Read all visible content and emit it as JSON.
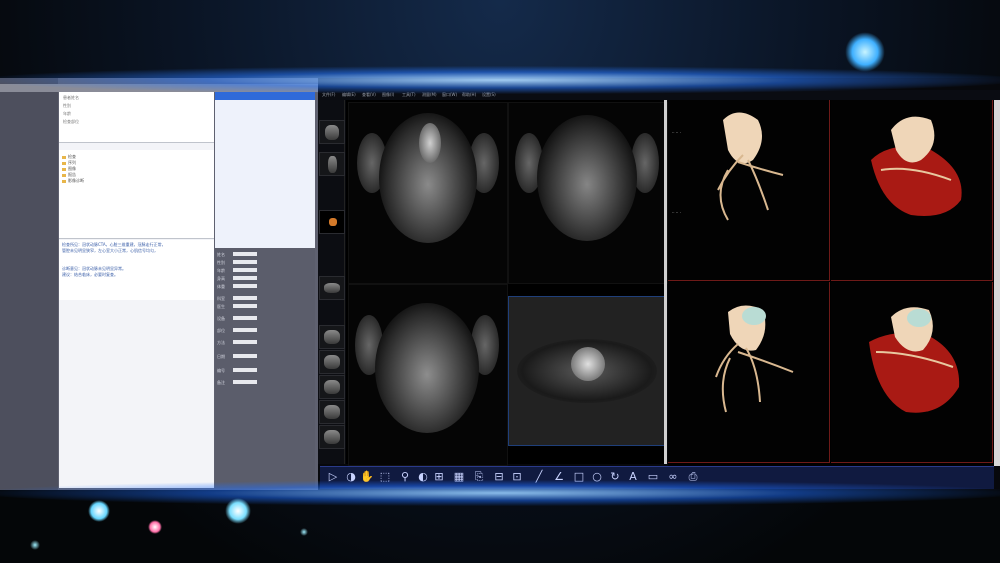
{
  "left_app": {
    "info_rows": [
      "患者姓名",
      "性别",
      "年龄",
      "检查部位"
    ],
    "tree_items": [
      "检查",
      "序列",
      "图像",
      "报告",
      "影像诊断"
    ],
    "notes": [
      "检查所见：冠状动脉CTA，心脏三维重建，冠脉走行正常，",
      "管腔未见明显狭窄，左心室大小正常，心肌信号均匀，",
      "诊断意见：冠状动脉未见明显异常。",
      "建议：结合临床，必要时复查。"
    ],
    "form_labels": [
      "姓名",
      "性别",
      "年龄",
      "身高",
      "体重",
      "科室",
      "医生",
      "设备",
      "部位",
      "方法",
      "日期",
      "编号",
      "备注"
    ]
  },
  "viewer": {
    "menu": [
      "文件(F)",
      "编辑(E)",
      "查看(V)",
      "图像(I)",
      "工具(T)",
      "测量(M)",
      "窗口(W)",
      "帮助(H)",
      "设置(S)",
      "报告(R)"
    ],
    "toolbar_icons": [
      "play-icon",
      "contrast-icon",
      "pan-icon",
      "select-icon",
      "zoom-icon",
      "invert-icon",
      "layout-icon",
      "grid-icon",
      "export-icon",
      "split-icon",
      "measure-icon",
      "line-icon",
      "angle-icon",
      "rectangle-icon",
      "ellipse-icon",
      "rotate-icon",
      "text-icon",
      "cine-icon",
      "link-icon",
      "print-icon"
    ],
    "thumbnails": [
      "chest-xray-thumb",
      "spine-thumb",
      "slice-thumb",
      "axial-thumb",
      "series-1",
      "series-2",
      "series-3",
      "series-4",
      "series-5",
      "series-6"
    ]
  },
  "colors": {
    "glow": "#4aa3ff",
    "toolbar": "#101a40",
    "heart": "#b21c16",
    "vessel": "#e8c8a0"
  }
}
